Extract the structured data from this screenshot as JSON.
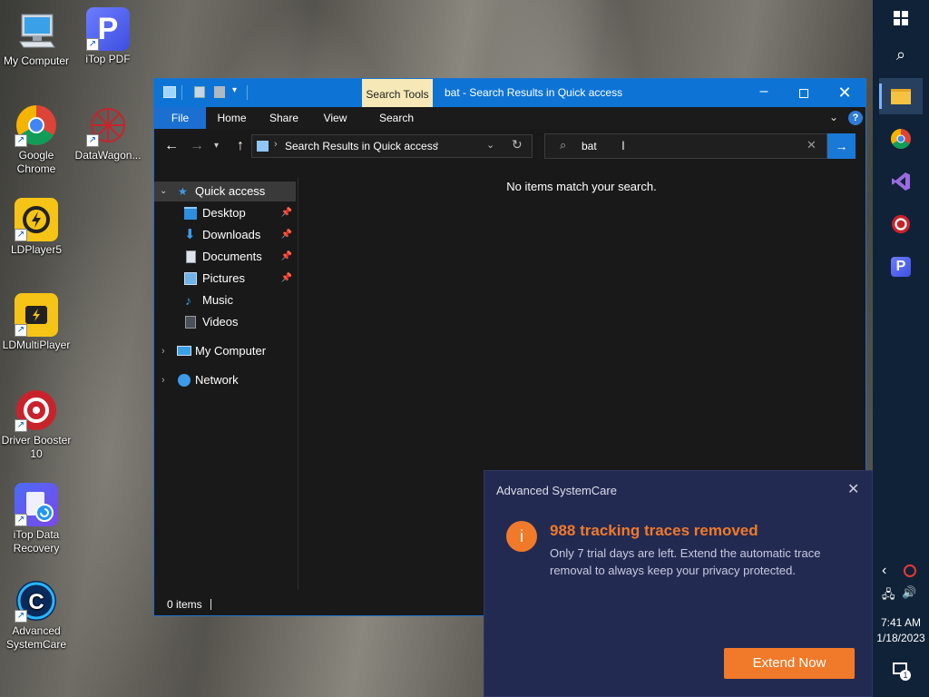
{
  "desktop": {
    "icons": [
      {
        "label": "My Computer",
        "icon": "monitor-icon"
      },
      {
        "label": "iTop PDF",
        "icon": "itop-pdf-icon"
      },
      {
        "label": "Google Chrome",
        "icon": "chrome-icon"
      },
      {
        "label": "DataWagon...",
        "icon": "datawagon-icon"
      },
      {
        "label": "LDPlayer5",
        "icon": "ldplayer-icon"
      },
      {
        "label": "LDMultiPlayer",
        "icon": "ldmultiplayer-icon"
      },
      {
        "label": "Driver Booster 10",
        "icon": "driver-booster-icon"
      },
      {
        "label": "iTop Data Recovery",
        "icon": "itop-data-recovery-icon"
      },
      {
        "label": "Advanced SystemCare",
        "icon": "advanced-systemcare-icon"
      }
    ]
  },
  "window": {
    "title": "bat - Search Results in Quick access",
    "context_tab": "Search Tools",
    "ribbon_tabs": [
      "File",
      "Home",
      "Share",
      "View",
      "Search"
    ],
    "address": "Search Results in Quick access",
    "search_value": "bat",
    "empty_message": "No items match your search.",
    "status": "0 items",
    "sidebar": {
      "quick_access": "Quick access",
      "items": [
        {
          "label": "Desktop",
          "pinned": true
        },
        {
          "label": "Downloads",
          "pinned": true
        },
        {
          "label": "Documents",
          "pinned": true
        },
        {
          "label": "Pictures",
          "pinned": true
        },
        {
          "label": "Music",
          "pinned": false
        },
        {
          "label": "Videos",
          "pinned": false
        }
      ],
      "my_computer": "My Computer",
      "network": "Network"
    },
    "colors": {
      "titlebar": "#0d74d6",
      "background": "#191919",
      "accent": "#1e72d0"
    }
  },
  "toast": {
    "app": "Advanced SystemCare",
    "headline": "988 tracking traces removed",
    "body": "Only 7 trial days are left. Extend the automatic trace removal to always keep your privacy protected.",
    "button": "Extend Now",
    "colors": {
      "background": "#232a52",
      "accent": "#f07a2a"
    }
  },
  "taskbar": {
    "time": "7:41 AM",
    "date": "1/18/2023",
    "notification_count": "1"
  }
}
